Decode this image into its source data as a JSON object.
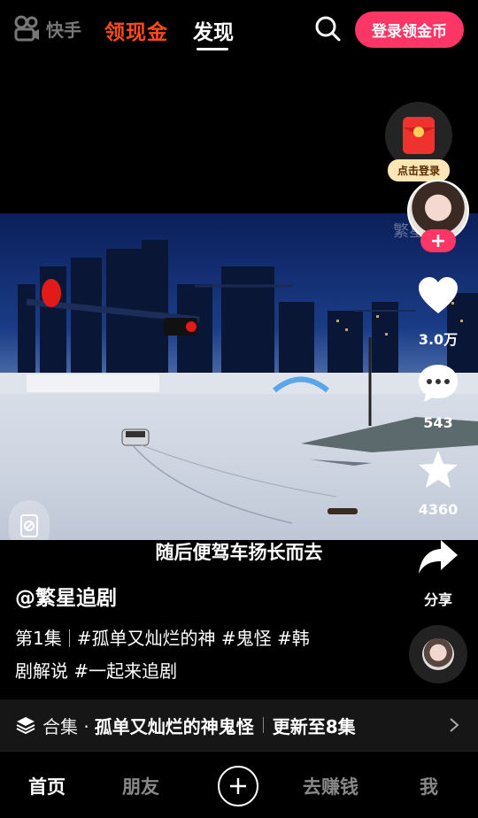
{
  "topbar": {
    "logo_text": "快手",
    "promo_label": "领现金",
    "active_tab": "发现",
    "login_button": "登录领金币"
  },
  "video": {
    "subtitle": "随后便驾车扬长而去",
    "overlay_ghost": "繁星追剧"
  },
  "rail": {
    "redpacket_tag": "点击登录",
    "avatar_ghost": "繁星追剧",
    "follow_label": "+",
    "likes": "3.0万",
    "comments": "543",
    "favorites": "4360",
    "share_label": "分享"
  },
  "post": {
    "author": "@繁星追剧",
    "episode": "第1集",
    "desc_line1": "#孤单又灿烂的神 #鬼怪 #韩",
    "desc_line2": "剧解说 #一起来追剧"
  },
  "collection": {
    "label": "合集 ·",
    "title": "孤单又灿烂的神鬼怪",
    "update": "更新至8集"
  },
  "nav": {
    "home": "首页",
    "friends": "朋友",
    "earn": "去赚钱",
    "me": "我"
  },
  "colors": {
    "accent_pink": "#fe3666",
    "promo_orange": "#ff4a1c"
  }
}
